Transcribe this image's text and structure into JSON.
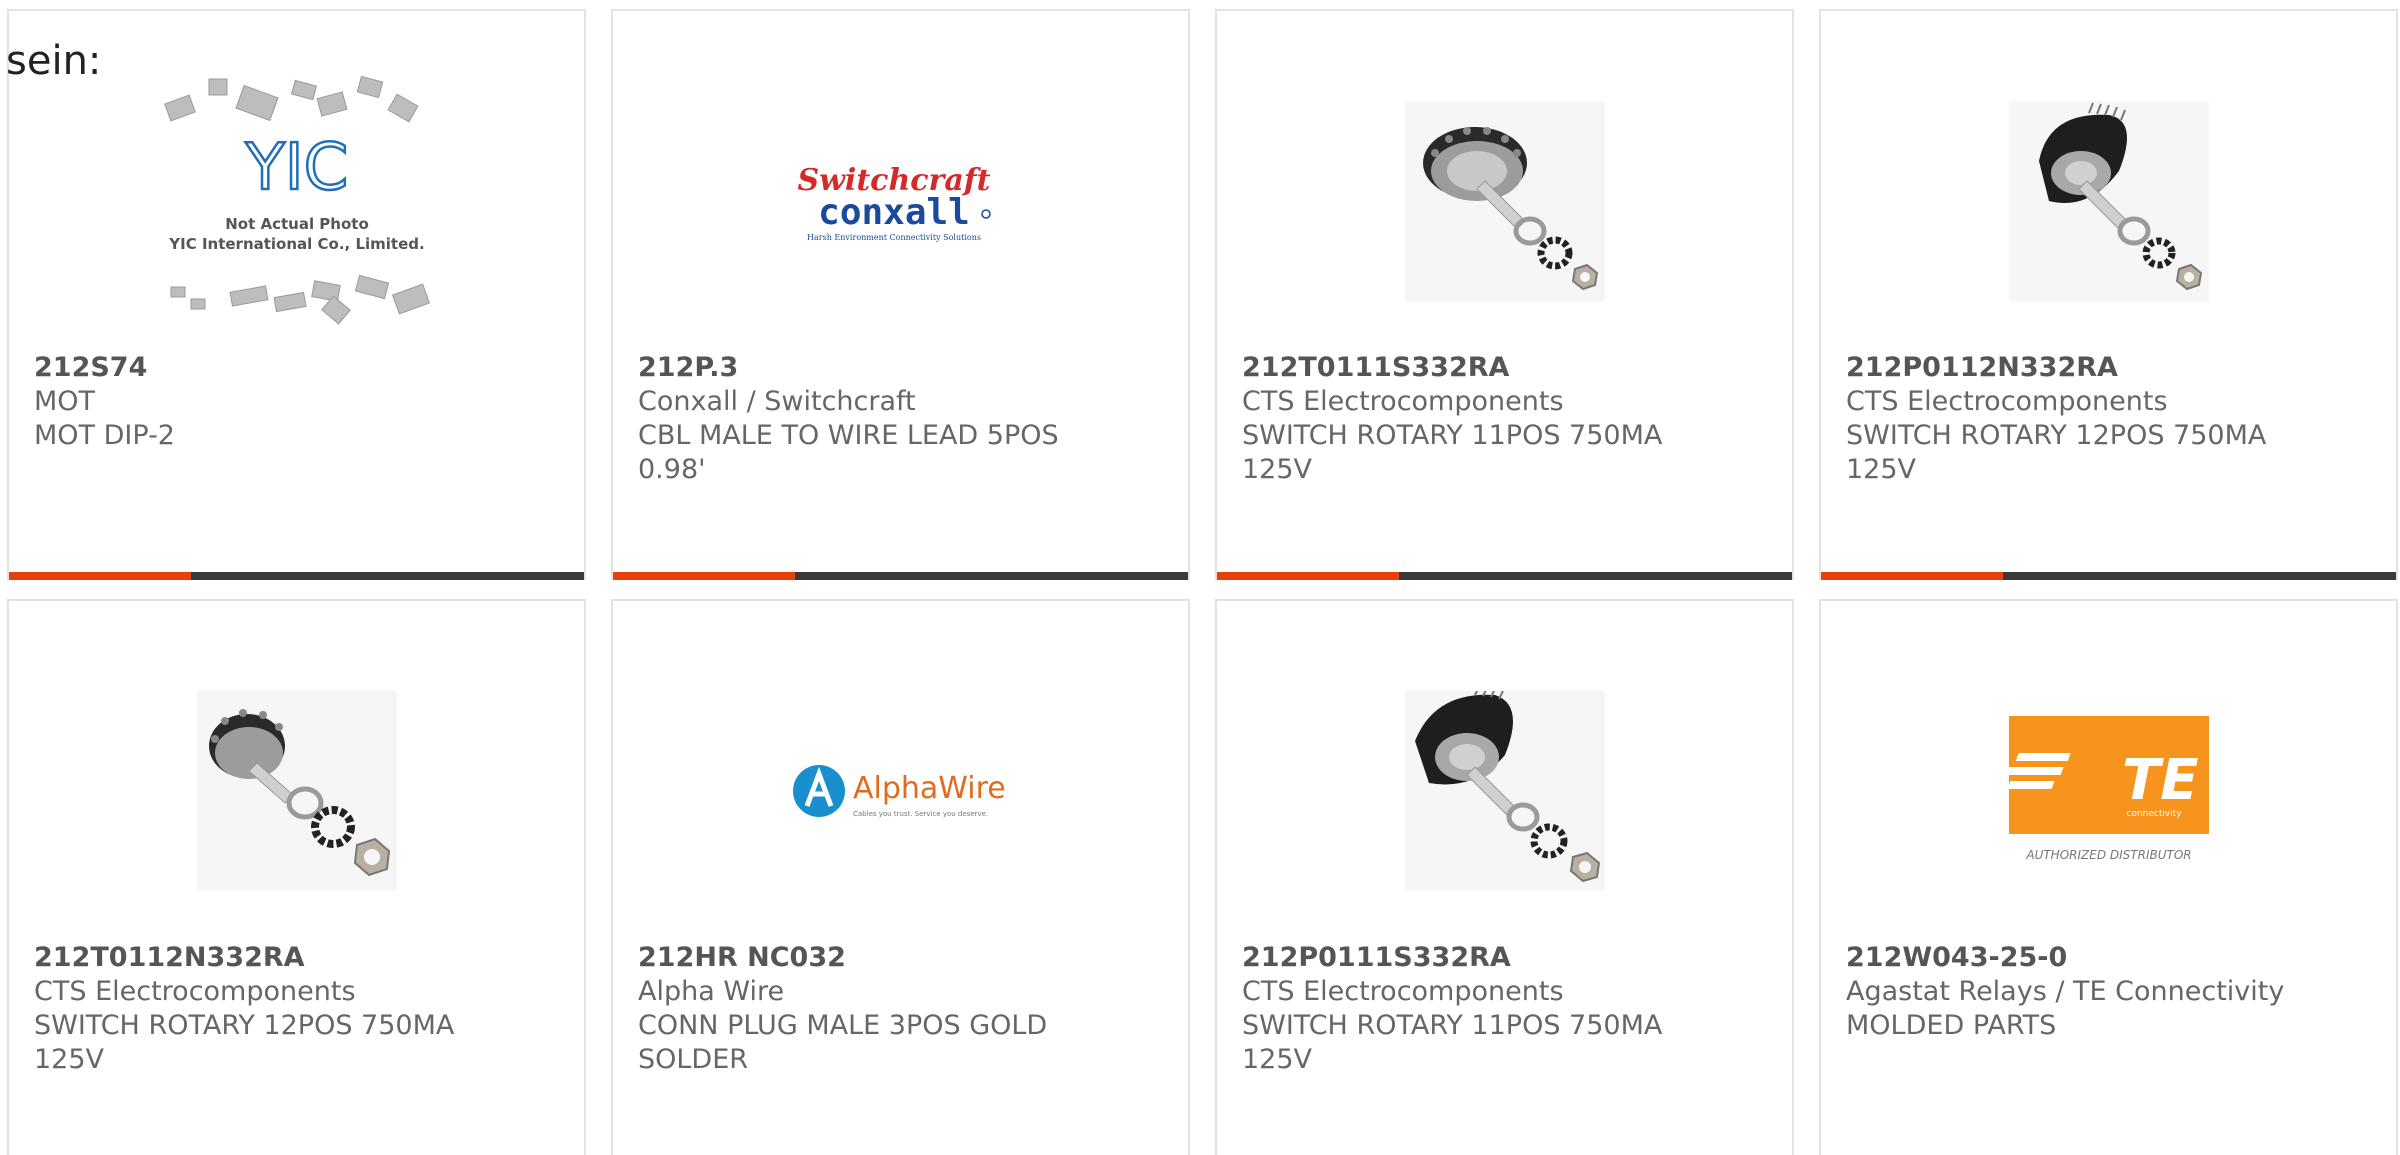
{
  "lead_text": "sein:",
  "colors": {
    "accent": "#e8400c",
    "bar": "#3a3a3a",
    "te_orange": "#f7941d",
    "yic_blue": "#1e6fb8",
    "switchcraft_red": "#d42a2a",
    "conxall_blue": "#1a4a9c",
    "alphawire_blue": "#1a8fd0"
  },
  "products": [
    {
      "part": "212S74",
      "maker": "MOT",
      "desc": "MOT DIP-2",
      "image": "yic-not-actual-photo",
      "yic": {
        "logo": "YIC",
        "note1": "Not Actual Photo",
        "note2": "YIC International Co., Limited."
      }
    },
    {
      "part": "212P.3",
      "maker": "Conxall / Switchcraft",
      "desc": "CBL MALE TO WIRE LEAD 5POS 0.98'",
      "image": "switchcraft-conxall-logo",
      "logo": {
        "top": "Switchcraft",
        "bottom": "conxall",
        "tagline": "Harsh Environment Connectivity Solutions"
      }
    },
    {
      "part": "212T0111S332RA",
      "maker": "CTS Electrocomponents",
      "desc": "SWITCH ROTARY 11POS 750MA 125V",
      "image": "rotary-switch"
    },
    {
      "part": "212P0112N332RA",
      "maker": "CTS Electrocomponents",
      "desc": "SWITCH ROTARY 12POS 750MA 125V",
      "image": "rotary-switch"
    },
    {
      "part": "212T0112N332RA",
      "maker": "CTS Electrocomponents",
      "desc": "SWITCH ROTARY 12POS 750MA 125V",
      "image": "rotary-switch"
    },
    {
      "part": "212HR NC032",
      "maker": "Alpha Wire",
      "desc": "CONN PLUG MALE 3POS GOLD SOLDER",
      "image": "alphawire-logo",
      "logo": {
        "name": "AlphaWire",
        "tagline": "Cables you trust. Service you deserve."
      }
    },
    {
      "part": "212P0111S332RA",
      "maker": "CTS Electrocomponents",
      "desc": "SWITCH ROTARY 11POS 750MA 125V",
      "image": "rotary-switch"
    },
    {
      "part": "212W043-25-0",
      "maker": "Agastat Relays / TE Connectivity",
      "desc": "MOLDED PARTS",
      "image": "te-connectivity-logo",
      "logo": {
        "name": "TE",
        "sub": "connectivity",
        "caption": "AUTHORIZED DISTRIBUTOR"
      }
    }
  ]
}
